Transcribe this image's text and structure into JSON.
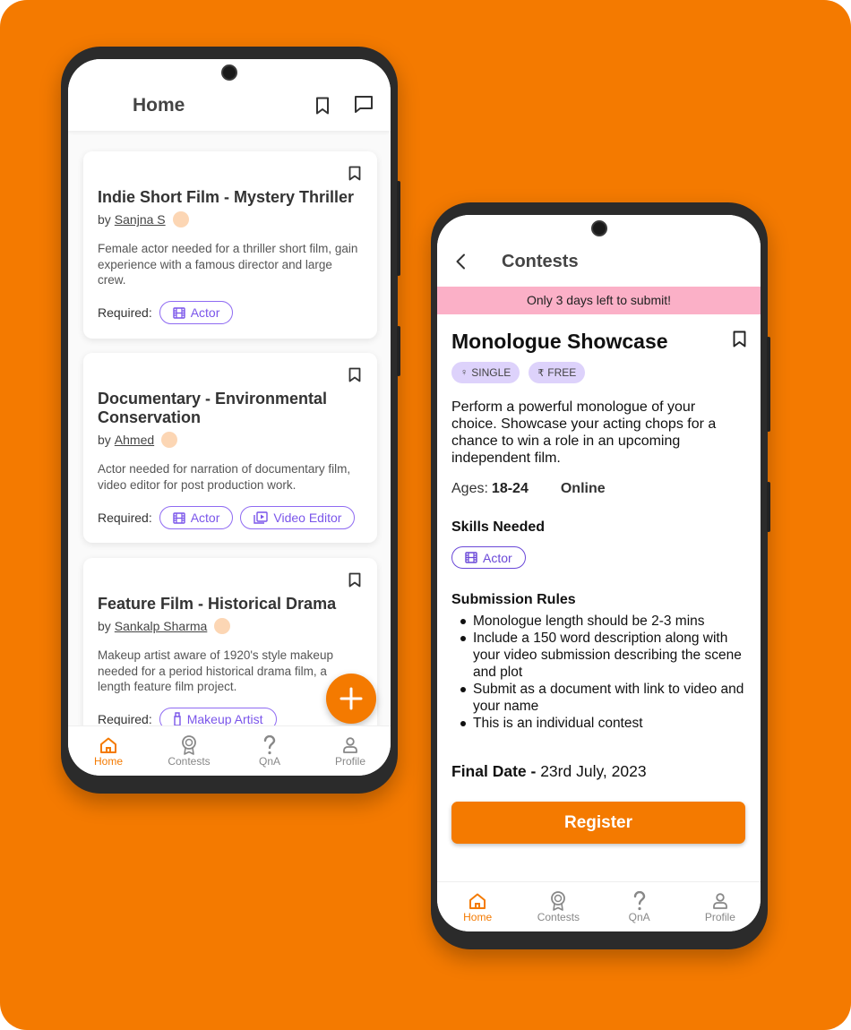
{
  "home_screen": {
    "title": "Home",
    "posts": [
      {
        "title": "Indie Short Film - Mystery Thriller",
        "by_prefix": "by",
        "author": "Sanjna S",
        "description": "Female actor needed for a thriller short film, gain experience with a famous director and large crew.",
        "required_label": "Required:",
        "roles": [
          "Actor"
        ]
      },
      {
        "title": "Documentary - Environmental Conservation",
        "by_prefix": "by",
        "author": "Ahmed",
        "description": "Actor needed for narration of documentary film, video editor for post production work.",
        "required_label": "Required:",
        "roles": [
          "Actor",
          "Video Editor"
        ]
      },
      {
        "title": "Feature Film - Historical Drama",
        "by_prefix": "by",
        "author": "Sankalp Sharma",
        "description": "Makeup artist aware of 1920's style makeup needed for a period historical drama film, a length feature film project.",
        "required_label": "Required:",
        "roles": [
          "Makeup Artist"
        ]
      }
    ],
    "nav": [
      {
        "label": "Home",
        "icon": "home-icon",
        "active": true
      },
      {
        "label": "Contests",
        "icon": "award-icon",
        "active": false
      },
      {
        "label": "QnA",
        "icon": "question-icon",
        "active": false
      },
      {
        "label": "Profile",
        "icon": "profile-icon",
        "active": false
      }
    ]
  },
  "contest_screen": {
    "title": "Contests",
    "banner": "Only 3 days left to submit!",
    "contest_title": "Monologue Showcase",
    "tags": [
      {
        "glyph": "♀",
        "label": "SINGLE"
      },
      {
        "glyph": "₹",
        "label": "FREE"
      }
    ],
    "description": "Perform a powerful monologue of your choice. Showcase your acting chops for a chance to win a role in an upcoming independent film.",
    "ages_label": "Ages:",
    "ages_value": "18-24",
    "mode": "Online",
    "skills_title": "Skills Needed",
    "skills": [
      "Actor"
    ],
    "rules_title": "Submission Rules",
    "rules": [
      "Monologue length should be 2-3 mins",
      "Include a 150 word description along with your video submission describing the scene and plot",
      "Submit as a document with link to video and your name",
      "This is an individual contest"
    ],
    "final_date_label": "Final Date -",
    "final_date_value": "23rd July, 2023",
    "register_label": "Register",
    "nav": [
      {
        "label": "Home",
        "icon": "home-icon",
        "active": true
      },
      {
        "label": "Contests",
        "icon": "award-icon",
        "active": false
      },
      {
        "label": "QnA",
        "icon": "question-icon",
        "active": false
      },
      {
        "label": "Profile",
        "icon": "profile-icon",
        "active": false
      }
    ]
  },
  "colors": {
    "background": "#f47a00",
    "accent": "#f47a00",
    "chip": "#7a55ea",
    "banner": "#fbb0c7",
    "tag": "#ddd2fb"
  }
}
